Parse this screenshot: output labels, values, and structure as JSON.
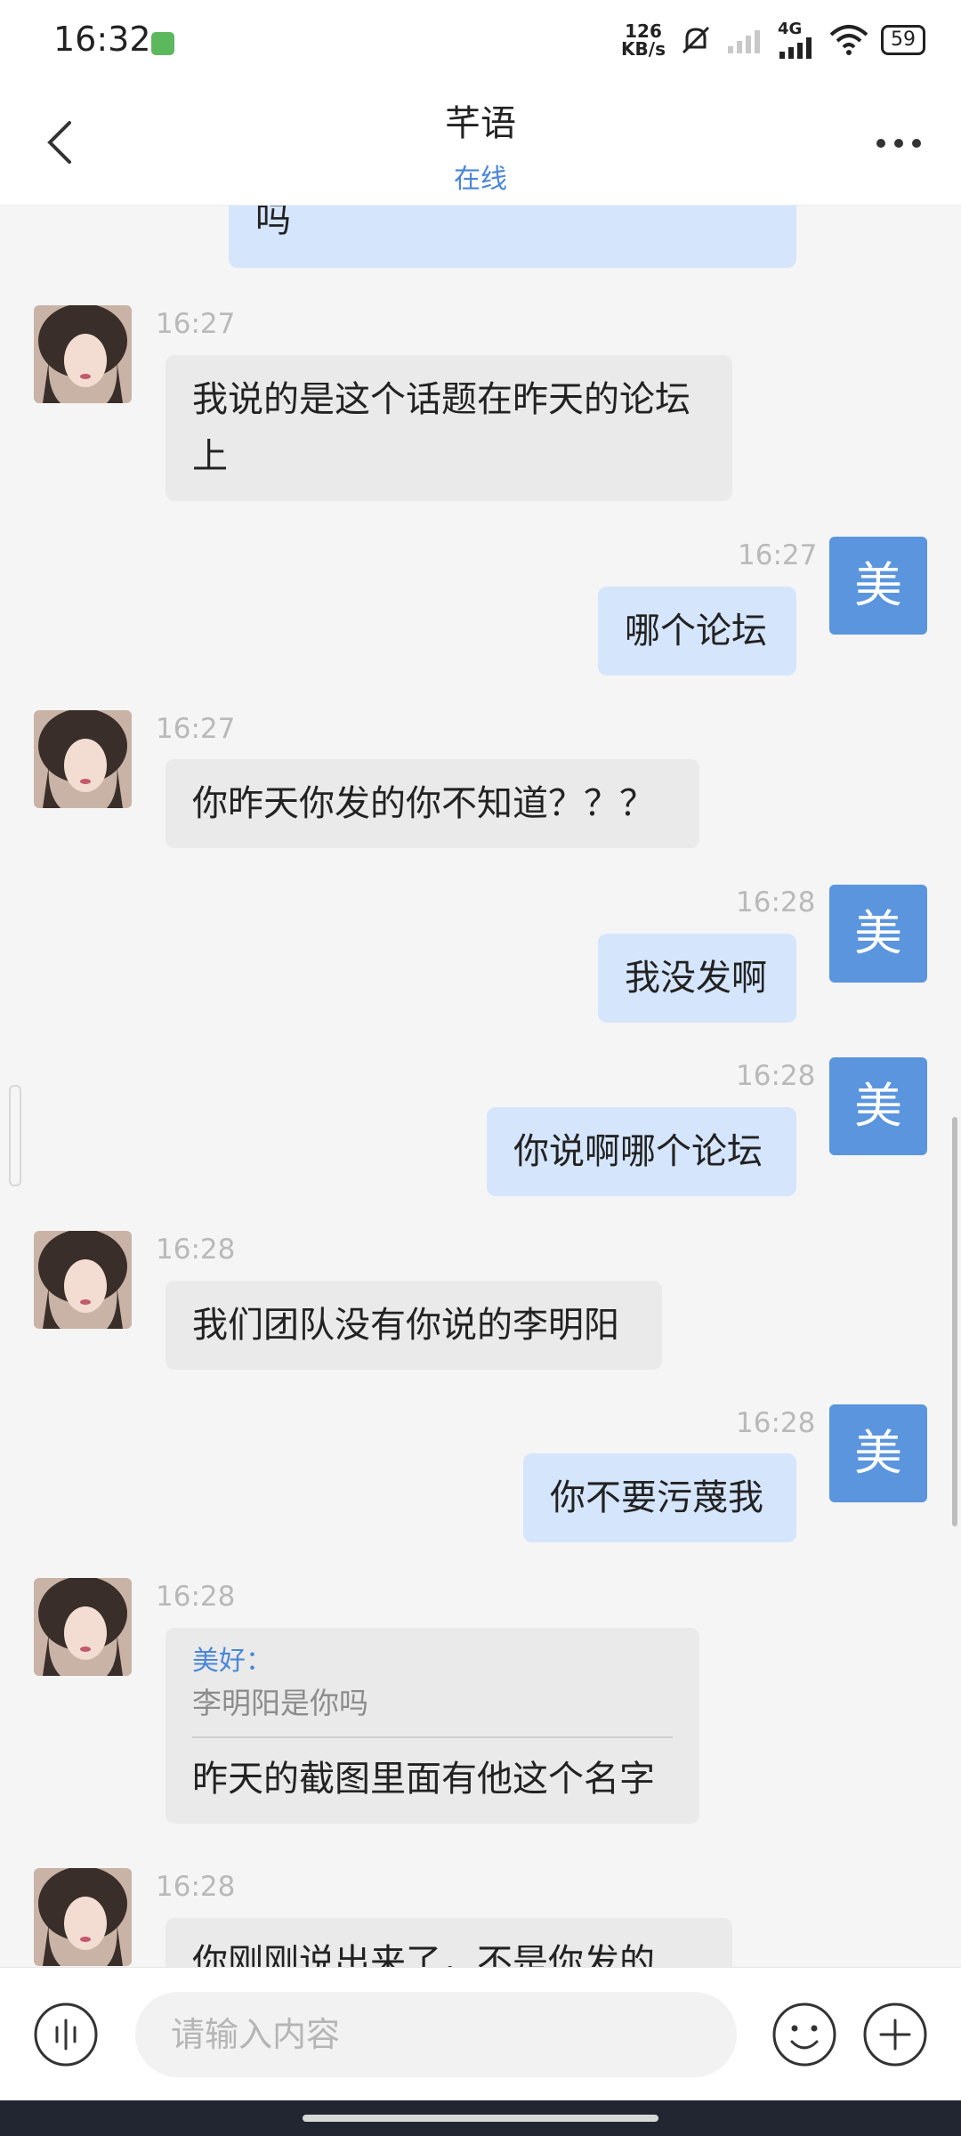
{
  "status_bar": {
    "time": "16:32",
    "net_speed_value": "126",
    "net_speed_unit": "KB/s",
    "network": "4G",
    "battery": "59"
  },
  "header": {
    "title": "芊语",
    "status": "在线"
  },
  "messages": [
    {
      "side": "right",
      "text": "吗"
    },
    {
      "side": "left",
      "time": "16:27",
      "text": "我说的是这个话题在昨天的论坛上"
    },
    {
      "side": "right",
      "time": "16:27",
      "text": "哪个论坛",
      "avatar": "美"
    },
    {
      "side": "left",
      "time": "16:27",
      "text": "你昨天你发的你不知道？？？"
    },
    {
      "side": "right",
      "time": "16:28",
      "text": "我没发啊",
      "avatar": "美"
    },
    {
      "side": "right",
      "time": "16:28",
      "text": "你说啊哪个论坛",
      "avatar": "美"
    },
    {
      "side": "left",
      "time": "16:28",
      "text": "我们团队没有你说的李明阳"
    },
    {
      "side": "right",
      "time": "16:28",
      "text": "你不要污蔑我",
      "avatar": "美"
    },
    {
      "side": "left",
      "time": "16:28",
      "quote_sender": "美好：",
      "quote_text": "李明阳是你吗",
      "text": "昨天的截图里面有他这个名字"
    },
    {
      "side": "left",
      "time": "16:28",
      "text": "你刚刚说出来了，不是你发的"
    }
  ],
  "input": {
    "placeholder": "请输入内容"
  },
  "colors": {
    "accent": "#4a86d9",
    "my_bubble": "#d5e5fc",
    "their_bubble": "#eaeaea",
    "my_avatar": "#5a95dd"
  }
}
